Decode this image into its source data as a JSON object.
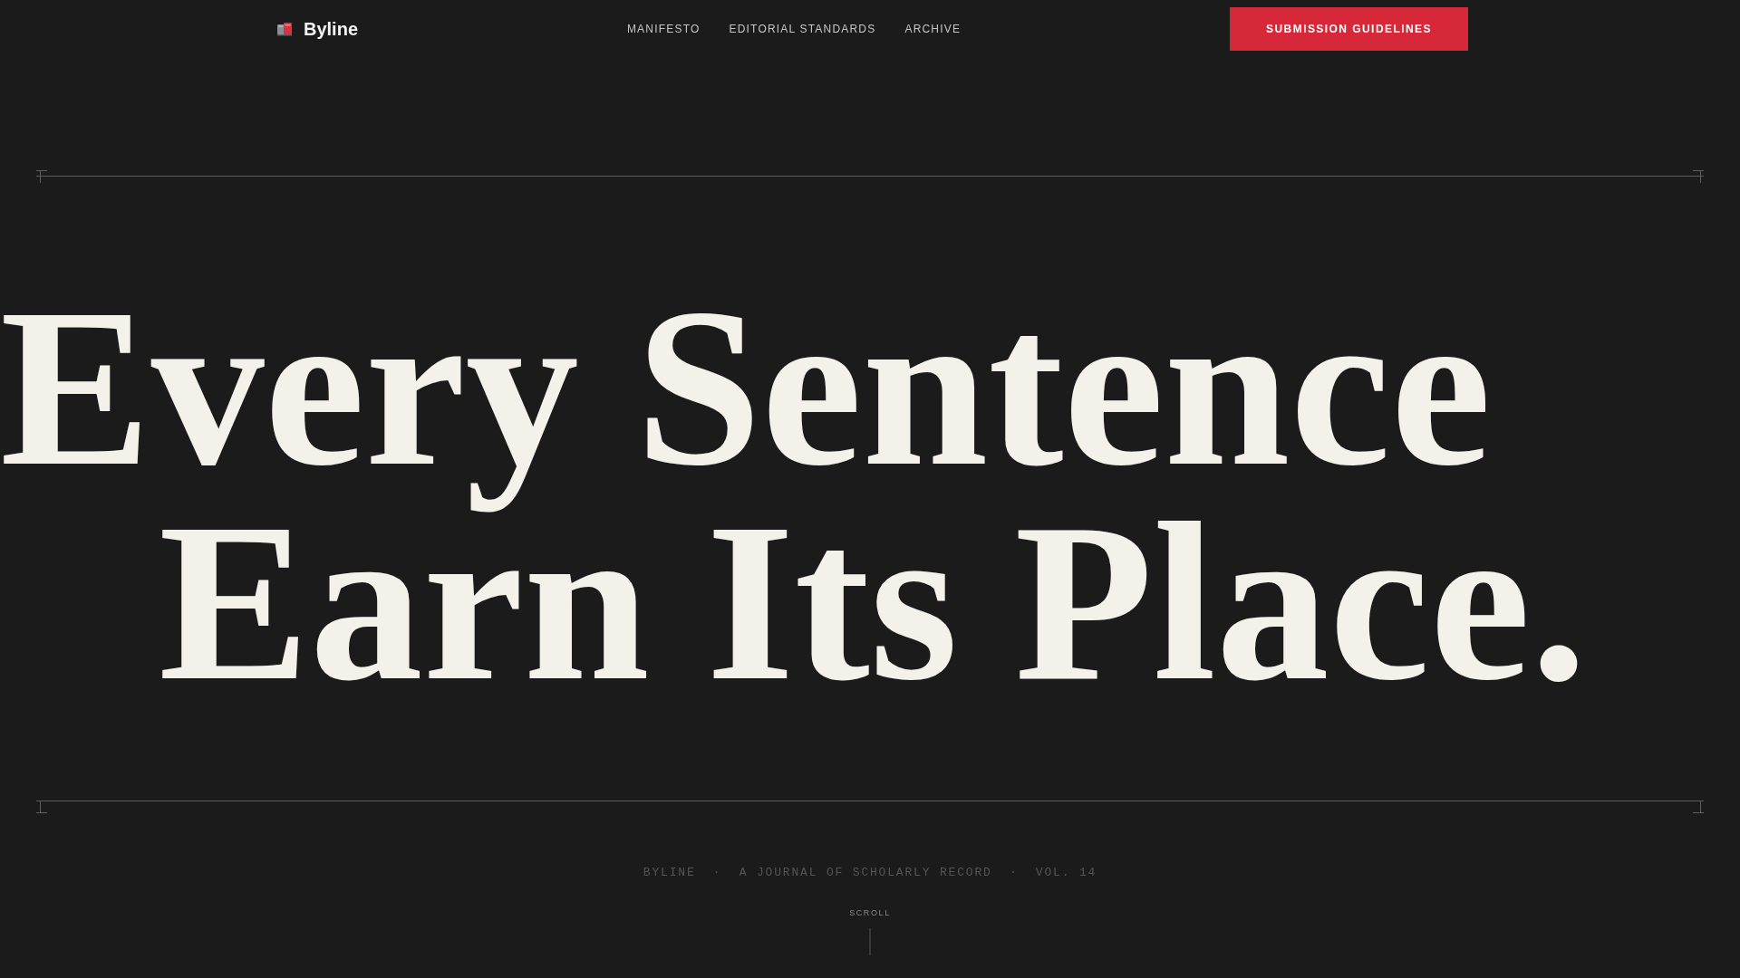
{
  "header": {
    "logo": "Byline",
    "nav": [
      "MANIFESTO",
      "EDITORIAL STANDARDS",
      "ARCHIVE"
    ],
    "button": "SUBMISSION GUIDELINES"
  },
  "hero": {
    "headline": [
      "Every Sentence",
      "Earn Its Place."
    ]
  },
  "footer": {
    "tagline": "BYLINE  ·  A JOURNAL OF SCHOLARLY RECORD  ·  VOL. 14",
    "scroll_label": "SCROLL"
  }
}
